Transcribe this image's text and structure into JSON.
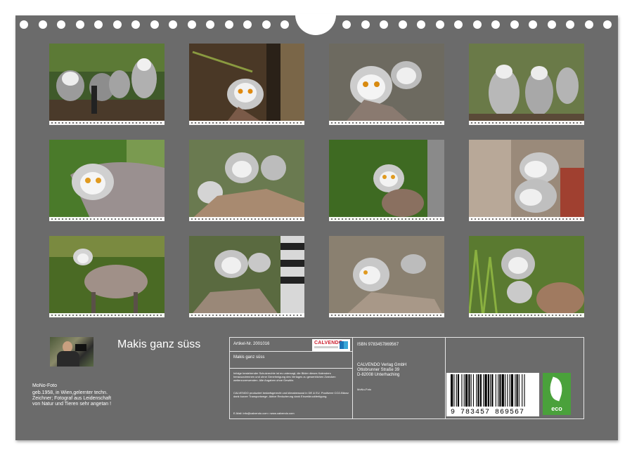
{
  "product": {
    "title": "Makis ganz süss",
    "article_label": "Artikel-Nr. 2001016",
    "article_title": "Makis ganz süss",
    "isbn": "ISBN 9783457869567",
    "barcode_digits": "9 783457 869567"
  },
  "publisher": {
    "logo_text": "CALVENDO",
    "name": "CALVENDO Verlag GmbH",
    "street": "Ottobrunner Straße 39",
    "city": "D-82008 Unterhaching"
  },
  "legal": {
    "copyright_text": "Infolge bestehender Schutzrechte ist es untersagt, die Bilder dieses Kalenders herauszutrennen und ohne Genehmigung des Verlages zu gewerblichen Zwecken weiterzuverwenden. Alle Angaben ohne Gewähr.",
    "eco_text": "CALVENDO produziert bedarfsgerecht und klimabewusst in DE & EU. Positivere CO2-Bilanz dank kurzer Transportwege. Aktive Reduzierung dank Einzeldruckfertigung.",
    "contact": "E-Mail: info@calvendo.com • www.calvendo.com"
  },
  "author": {
    "name": "MoNo-Foto",
    "bio": "geb.1958, in Wien,gelernter techn. Zeichner; Fotograf aus Leidenschaft von Natur und Tieren sehr angetan !",
    "small_label": "MoNo-Foto"
  },
  "eco_badge": {
    "label": "eco",
    "color": "#4aa13b"
  },
  "colors": {
    "background": "#6b6b6b",
    "calvendo_red": "#cc1f2f"
  },
  "barcode_bars": [
    3,
    1,
    1,
    2,
    1,
    1,
    2,
    3,
    1,
    2,
    1,
    1,
    3,
    1,
    2,
    1,
    1,
    2,
    1,
    3,
    1,
    1,
    2,
    1,
    2,
    2,
    1,
    1,
    3,
    1,
    2,
    1,
    1,
    1,
    2,
    3,
    1,
    2,
    1,
    1,
    2,
    1,
    3,
    1,
    1,
    2,
    1,
    2,
    1,
    1,
    3,
    2,
    1,
    1,
    2,
    1,
    1,
    3,
    1,
    2,
    1,
    2
  ]
}
